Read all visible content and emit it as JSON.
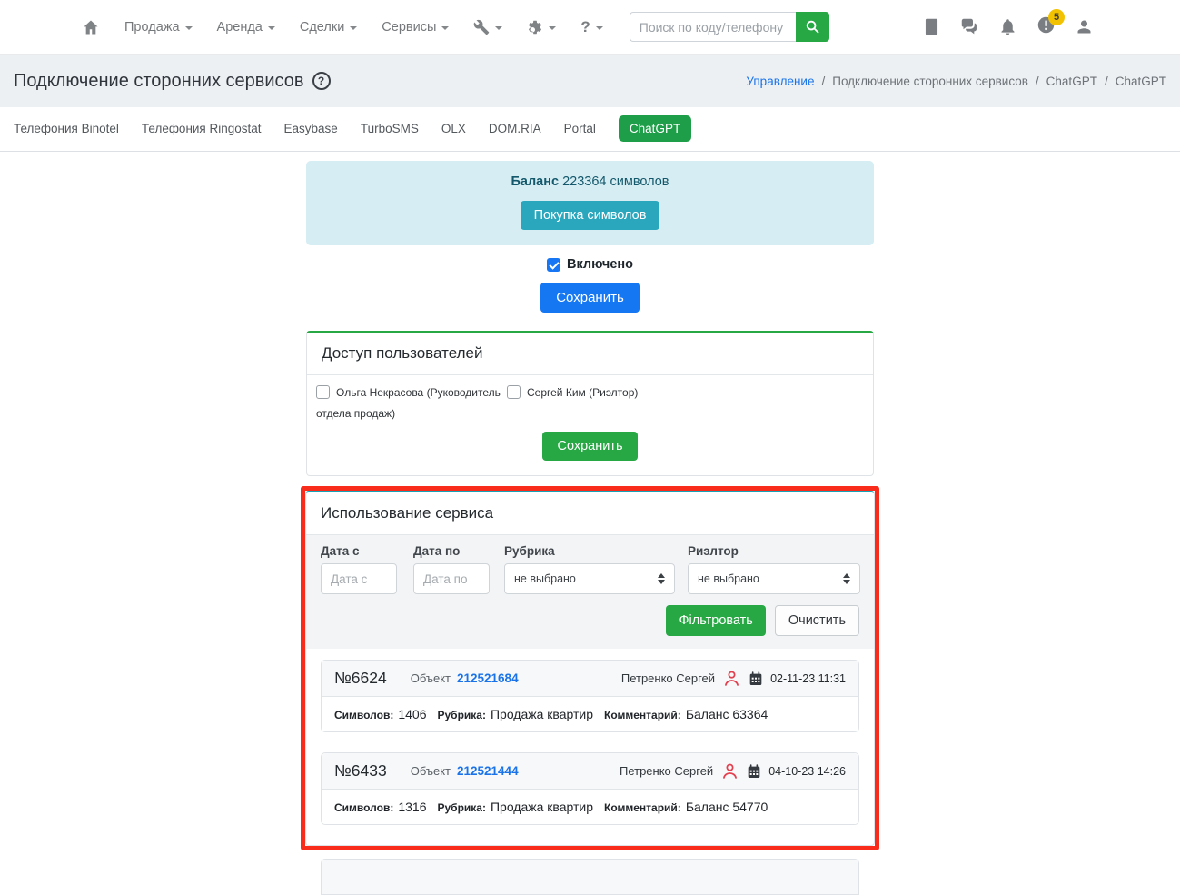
{
  "navbar": {
    "menu": [
      {
        "label": "Продажа"
      },
      {
        "label": "Аренда"
      },
      {
        "label": "Сделки"
      },
      {
        "label": "Сервисы"
      }
    ],
    "help_label": "?",
    "search": {
      "placeholder": "Поиск по коду/телефону"
    },
    "badge_count": "5"
  },
  "page": {
    "title": "Подключение сторонних сервисов",
    "help_glyph": "?",
    "breadcrumb_separator": "/",
    "breadcrumb": [
      {
        "label": "Управление"
      },
      {
        "label": "Подключение сторонних сервисов"
      },
      {
        "label": "ChatGPT"
      },
      {
        "label": "ChatGPT"
      }
    ]
  },
  "tabs": [
    {
      "label": "Телефония Binotel"
    },
    {
      "label": "Телефония Ringostat"
    },
    {
      "label": "Easybase"
    },
    {
      "label": "TurboSMS"
    },
    {
      "label": "OLX"
    },
    {
      "label": "DOM.RIA"
    },
    {
      "label": "Portal"
    },
    {
      "label": "ChatGPT",
      "active": true
    }
  ],
  "balance": {
    "label": "Баланс",
    "value": "223364",
    "suffix": "символов",
    "buy_button": "Покупка символов"
  },
  "enable": {
    "label": "Включено",
    "checked": true,
    "save_button": "Сохранить"
  },
  "user_access": {
    "title": "Доступ пользователей",
    "users": [
      {
        "label": "Ольга Некрасова (Руководитель отдела продаж)",
        "checked": false
      },
      {
        "label": "Сергей Ким (Риэлтор)",
        "checked": false
      }
    ],
    "save_button": "Сохранить"
  },
  "usage": {
    "title": "Использование сервиса",
    "filters": {
      "date_from": {
        "label": "Дата с",
        "placeholder": "Дата с"
      },
      "date_to": {
        "label": "Дата по",
        "placeholder": "Дата по"
      },
      "rubric": {
        "label": "Рубрика",
        "value": "не выбрано"
      },
      "realtor": {
        "label": "Риэлтор",
        "value": "не выбрано"
      },
      "filter_button": "Фільтровать",
      "clear_button": "Очистить"
    },
    "records": [
      {
        "number": "№6624",
        "object_label": "Объект",
        "object_id": "212521684",
        "agent": "Петренко Сергей",
        "datetime": "02-11-23 11:31",
        "symbols_label": "Символов:",
        "symbols": "1406",
        "rubric_label": "Рубрика:",
        "rubric": "Продажа квартир",
        "comment_label": "Комментарий:",
        "comment": "Баланс 63364"
      },
      {
        "number": "№6433",
        "object_label": "Объект",
        "object_id": "212521444",
        "agent": "Петренко Сергей",
        "datetime": "04-10-23 14:26",
        "symbols_label": "Символов:",
        "symbols": "1316",
        "rubric_label": "Рубрика:",
        "rubric": "Продажа квартир",
        "comment_label": "Комментарий:",
        "comment": "Баланс 54770"
      }
    ]
  },
  "icons": {
    "home-icon": "house",
    "wrench-icon": "wrench",
    "gear-icon": "gear",
    "help-icon": "?",
    "search-icon": "magnifier",
    "notes-icon": "notebook",
    "chat-icon": "speech-bubbles",
    "bell-icon": "bell",
    "alerts-icon": "exclamation-circle",
    "user-icon": "person",
    "agent-icon": "person-outline",
    "calendar-icon": "calendar"
  },
  "colors": {
    "active_tab_green": "#1f9e49",
    "accent_green": "#28a745",
    "accent_blue": "#1677f3",
    "accent_teal": "#2ba7bd",
    "alert_bg": "#d5edf3",
    "link_blue": "#1a73e8",
    "bell_red": "#e84855",
    "badge_yellow": "#f2c200",
    "annotation_red": "#f92b1b"
  }
}
